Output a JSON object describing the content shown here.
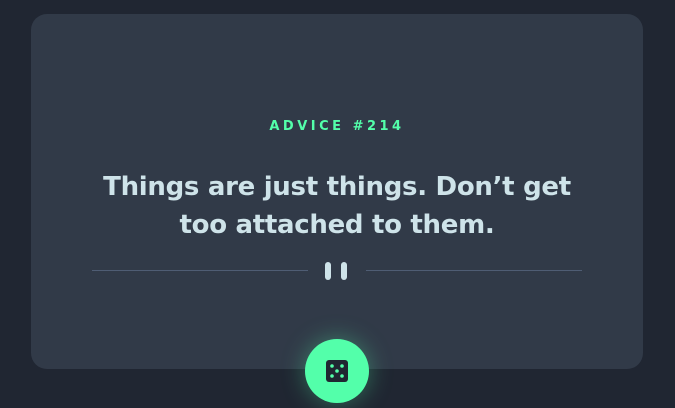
{
  "advice": {
    "id_label": "ADVICE #214",
    "text": "Things are just things. Don’t get too attached to them."
  },
  "divider": {
    "icon": "pause-icon"
  },
  "button": {
    "icon": "dice-icon",
    "accent_color": "#53ffaa"
  },
  "colors": {
    "background": "#202632",
    "card": "#313a48",
    "text": "#cee3e9",
    "divider": "#4f5d74"
  }
}
